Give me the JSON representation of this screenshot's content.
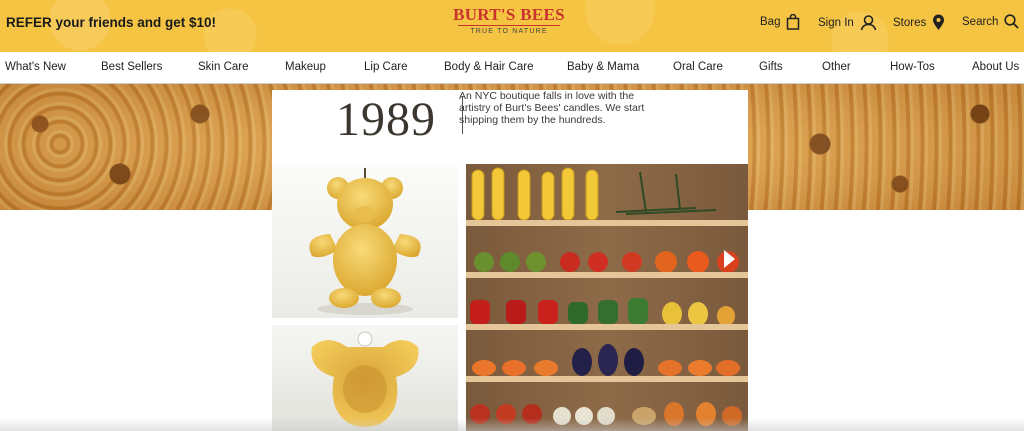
{
  "header": {
    "promo": "REFER your friends and get $10!",
    "logo_name": "BURT'S BEES",
    "logo_tagline": "TRUE TO NATURE",
    "bag_label": "Bag",
    "sign_in_label": "Sign In",
    "stores_label": "Stores",
    "search_label": "Search"
  },
  "nav": {
    "items": [
      "What's New",
      "Best Sellers",
      "Skin Care",
      "Makeup",
      "Lip Care",
      "Body & Hair Care",
      "Baby & Mama",
      "Oral Care",
      "Gifts",
      "Other",
      "How-Tos",
      "About Us"
    ]
  },
  "timeline": {
    "year": "1989",
    "blurb": "An NYC boutique falls in love with the artistry of Burt's Bees' candles. We start shipping them by the hundreds."
  },
  "colors": {
    "brand_yellow": "#f6c443",
    "brand_red": "#c8342d",
    "wax": "#f0c24a"
  }
}
